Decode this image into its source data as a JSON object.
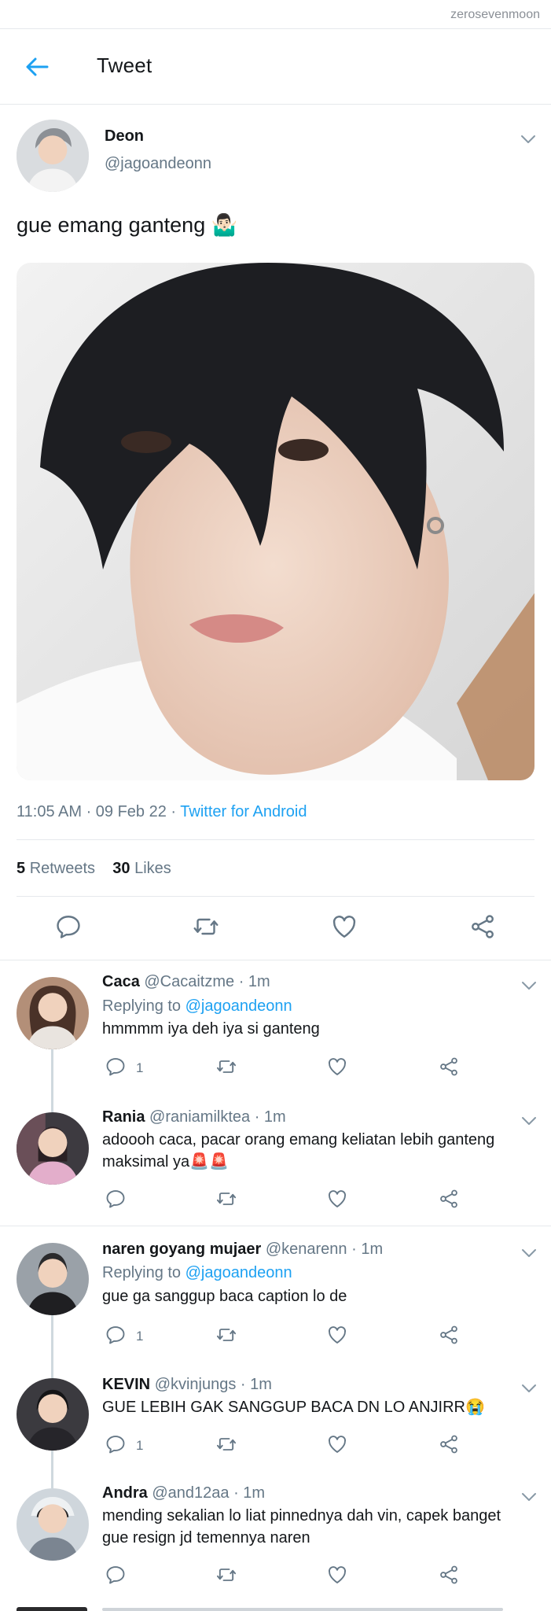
{
  "watermark": "zerosevenmoon",
  "header": {
    "title": "Tweet",
    "back_icon": "arrow-left-icon"
  },
  "colors": {
    "accent": "#1da1f2",
    "muted": "#657786",
    "text": "#14171a",
    "divider": "#e6e9ec"
  },
  "tweet": {
    "name": "Deon",
    "handle": "@jagoandeonn",
    "text": "gue emang ganteng 🤷🏻‍♂️",
    "time": "11:05 AM · 09 Feb 22 · ",
    "source": "Twitter for Android",
    "retweets": "5",
    "retweets_label": "Retweets",
    "likes": "30",
    "likes_label": "Likes"
  },
  "replies": [
    {
      "name": "Caca",
      "meta": "@Cacaitzme · 1m",
      "replying_prefix": "Replying to ",
      "replying_to": "@jagoandeonn",
      "text": "hmmmm iya deh iya si ganteng",
      "reply_count": "1"
    },
    {
      "name": "Rania",
      "meta": "@raniamilktea · 1m",
      "text_line1": "adoooh caca, pacar orang emang keliatan lebih ganteng",
      "text_line2": "maksimal ya🚨🚨"
    },
    {
      "name": "naren goyang mujaer",
      "meta": "@kenarenn · 1m",
      "replying_prefix": "Replying to ",
      "replying_to": "@jagoandeonn",
      "text": "gue ga sanggup baca caption lo de",
      "reply_count": "1"
    },
    {
      "name": "KEVIN",
      "meta": "@kvinjungs · 1m",
      "text": "GUE LEBIH GAK SANGGUP BACA DN LO ANJIRR😭",
      "reply_count": "1"
    },
    {
      "name": "Andra",
      "meta": "@and12aa · 1m",
      "text_line1": "mending sekalian lo liat pinnednya dah vin, capek banget",
      "text_line2": "gue resign jd temennya naren"
    }
  ]
}
